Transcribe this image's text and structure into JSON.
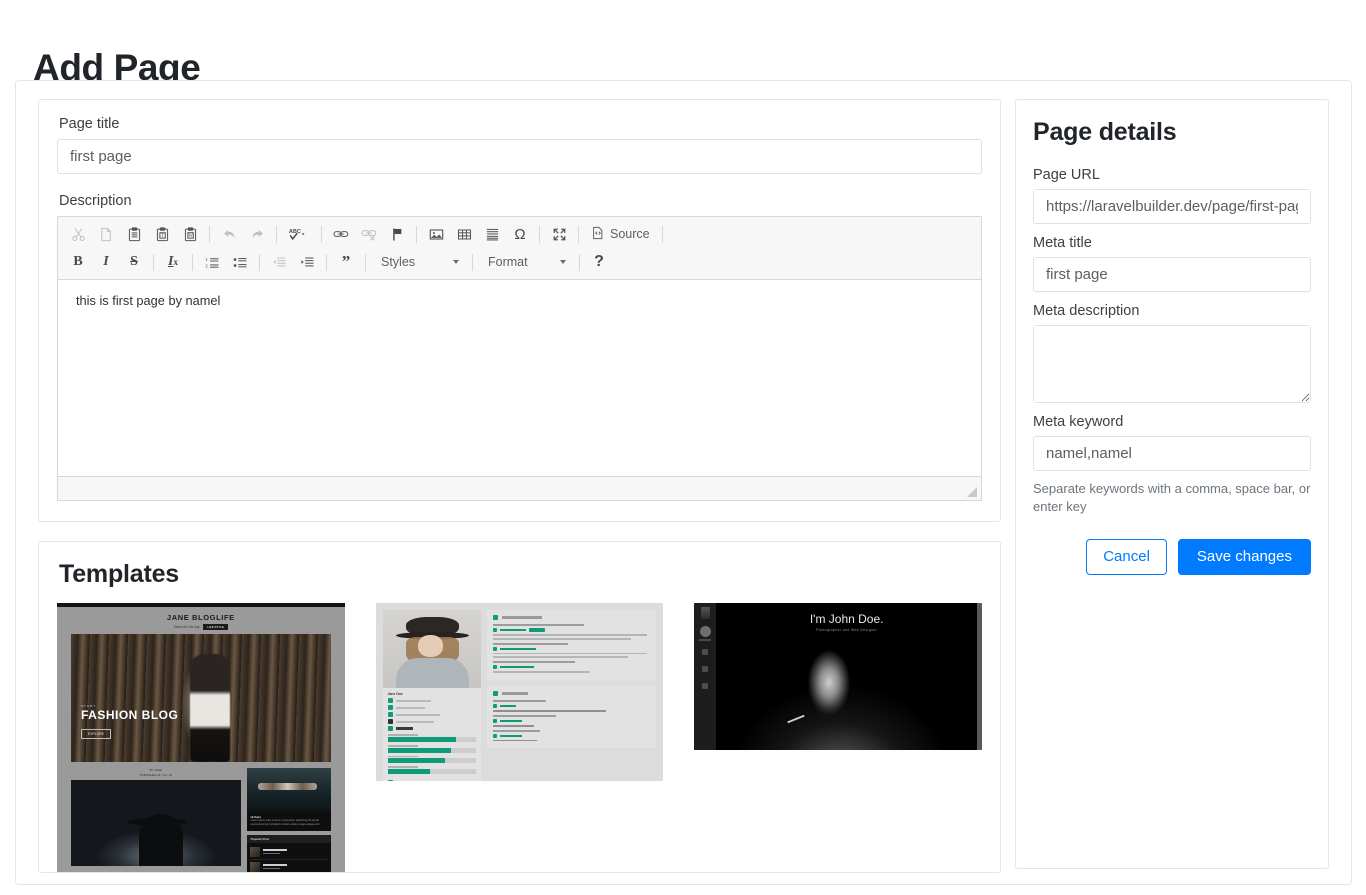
{
  "page": {
    "heading": "Add Page"
  },
  "form": {
    "page_title_label": "Page title",
    "page_title_value": "first page",
    "description_label": "Description",
    "editor_content": "this is first page by namel"
  },
  "editor": {
    "toolbar_row1": [
      {
        "name": "cut-icon",
        "title": "Cut",
        "disabled": true
      },
      {
        "name": "copy-icon",
        "title": "Copy",
        "disabled": true
      },
      {
        "name": "paste-icon",
        "title": "Paste",
        "disabled": false
      },
      {
        "name": "paste-as-plain-text-icon",
        "title": "Paste as plain text",
        "disabled": false
      },
      {
        "name": "paste-from-word-icon",
        "title": "Paste from Word",
        "disabled": false
      },
      {
        "name": "undo-icon",
        "title": "Undo",
        "disabled": true
      },
      {
        "name": "redo-icon",
        "title": "Redo",
        "disabled": true
      },
      {
        "name": "spell-check-icon",
        "title": "Spell Check As You Type",
        "disabled": false
      },
      {
        "name": "link-icon",
        "title": "Link",
        "disabled": false
      },
      {
        "name": "unlink-icon",
        "title": "Unlink",
        "disabled": true
      },
      {
        "name": "anchor-icon",
        "title": "Anchor",
        "disabled": false
      },
      {
        "name": "image-icon",
        "title": "Image",
        "disabled": false
      },
      {
        "name": "table-icon",
        "title": "Table",
        "disabled": false
      },
      {
        "name": "horizontal-line-icon",
        "title": "Insert Horizontal Line",
        "disabled": false
      },
      {
        "name": "special-character-icon",
        "title": "Insert Special Character",
        "disabled": false
      },
      {
        "name": "maximize-icon",
        "title": "Maximize",
        "disabled": false
      },
      {
        "name": "source-icon",
        "title": "Source",
        "disabled": false
      }
    ],
    "source_label": "Source",
    "toolbar_row2": [
      {
        "name": "bold-icon",
        "title": "Bold",
        "disabled": false
      },
      {
        "name": "italic-icon",
        "title": "Italic",
        "disabled": false
      },
      {
        "name": "strikethrough-icon",
        "title": "Strikethrough",
        "disabled": false
      },
      {
        "name": "remove-format-icon",
        "title": "Remove Format",
        "disabled": false
      },
      {
        "name": "numbered-list-icon",
        "title": "Insert/Remove Numbered List",
        "disabled": false
      },
      {
        "name": "bulleted-list-icon",
        "title": "Insert/Remove Bulleted List",
        "disabled": false
      },
      {
        "name": "decrease-indent-icon",
        "title": "Decrease Indent",
        "disabled": true
      },
      {
        "name": "increase-indent-icon",
        "title": "Increase Indent",
        "disabled": false
      },
      {
        "name": "blockquote-icon",
        "title": "Block Quote",
        "disabled": false
      }
    ],
    "styles_label": "Styles",
    "format_label": "Format",
    "help_label": "?"
  },
  "templates": {
    "title": "Templates",
    "items": [
      {
        "name": "fashion-blog-template",
        "brand": "JANE BLOGLIFE",
        "tagline": "Stories for the day",
        "pill": "LIFE STYLE",
        "kicker": "STORY",
        "hero_title": "FASHION BLOG",
        "hero_button": "EXPLORE",
        "meta_line1": "BY JANE",
        "meta_line2": "PUBLISHED 11 / 11 / 19",
        "side_caption_title": "Hi there",
        "side_bar_label": "Popular Post"
      },
      {
        "name": "resume-template",
        "person": "Jane Doe"
      },
      {
        "name": "dark-portfolio-template",
        "title": "I'm John Doe.",
        "subtitle": "Photographer and Web Designer"
      }
    ]
  },
  "details": {
    "title": "Page details",
    "page_url_label": "Page URL",
    "page_url_value": "https://laravelbuilder.dev/page/first-page",
    "meta_title_label": "Meta title",
    "meta_title_value": "first page",
    "meta_description_label": "Meta description",
    "meta_description_value": "",
    "meta_keyword_label": "Meta keyword",
    "meta_keyword_value": "namel,namel",
    "hint": "Separate keywords with a comma, space bar, or enter key",
    "cancel_label": "Cancel",
    "save_label": "Save changes"
  },
  "colors": {
    "primary": "#007bff",
    "accent_green": "#0f9b77",
    "text": "#212529",
    "muted": "#6c757d",
    "border": "#dfe1e3"
  }
}
